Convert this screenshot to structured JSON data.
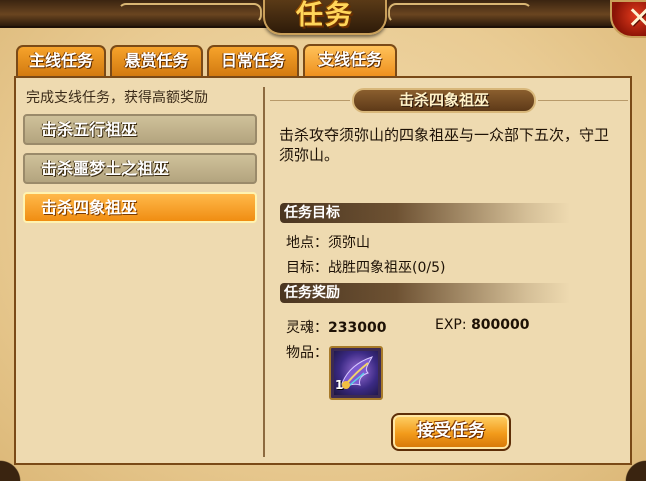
{
  "window": {
    "title": "任务",
    "close_icon": "close-icon"
  },
  "tabs": [
    {
      "label": "主线任务",
      "active": false
    },
    {
      "label": "悬赏任务",
      "active": false
    },
    {
      "label": "日常任务",
      "active": false
    },
    {
      "label": "支线任务",
      "active": true
    }
  ],
  "left_panel": {
    "header": "完成支线任务，获得高额奖励",
    "quests": [
      {
        "label": "击杀五行祖巫",
        "selected": false
      },
      {
        "label": "击杀噩梦土之祖巫",
        "selected": false
      },
      {
        "label": "击杀四象祖巫",
        "selected": true
      }
    ]
  },
  "detail": {
    "title": "击杀四象祖巫",
    "description": "击杀攻夺须弥山的四象祖巫与一众部下五次，守卫须弥山。",
    "objective_header": "任务目标",
    "location": "地点：须弥山",
    "target": "目标：战胜四象祖巫(0/5)",
    "reward_header": "任务奖励",
    "soul_label": "灵魂：",
    "soul_value": "233000",
    "exp_label": "EXP:",
    "exp_value": "800000",
    "items_label": "物品：",
    "item": {
      "icon": "wing-item-icon",
      "count": "1"
    },
    "accept_button": "接受任务"
  },
  "colors": {
    "tab_orange": "#f6a32b",
    "selected_orange": "#f08d12",
    "parchment": "#eedab0",
    "frame_brown": "#7a4a17"
  }
}
